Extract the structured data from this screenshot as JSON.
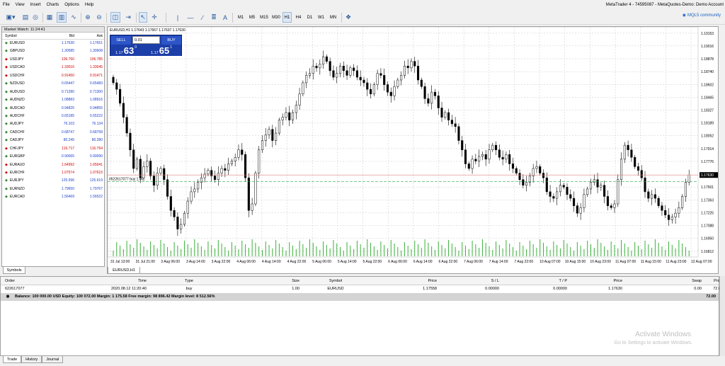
{
  "menu": [
    "File",
    "View",
    "Insert",
    "Charts",
    "Options",
    "Help"
  ],
  "title": "MetaTrader 4 - 74595087 - MetaQuotes-Demo: Demo Account",
  "toolbar": {
    "timeframes": [
      "M1",
      "M5",
      "M15",
      "M30",
      "H1",
      "H4",
      "D1",
      "W1",
      "MN"
    ],
    "selected_timeframe": "H1",
    "mql5_link": "MQL5 community"
  },
  "market_watch": {
    "title": "Market Watch: 11:24:41",
    "col_symbol": "Symbol",
    "col_bid": "Bid",
    "col_ask": "Ask",
    "tab": "Symbols",
    "rows": [
      {
        "symbol": "EURUSD",
        "bid": "1.17630",
        "ask": "1.17651",
        "dir": "up"
      },
      {
        "symbol": "GBPUSD",
        "bid": "1.30585",
        "ask": "1.30608",
        "dir": "up"
      },
      {
        "symbol": "USDJPY",
        "bid": "106.760",
        "ask": "106.785",
        "dir": "down"
      },
      {
        "symbol": "USDCAD",
        "bid": "1.33016",
        "ask": "1.33045",
        "dir": "down"
      },
      {
        "symbol": "USDCHF",
        "bid": "0.91450",
        "ask": "0.91471",
        "dir": "down"
      },
      {
        "symbol": "NZDUSD",
        "bid": "0.65447",
        "ask": "0.65483",
        "dir": "up"
      },
      {
        "symbol": "AUDUSD",
        "bid": "0.71280",
        "ask": "0.71300",
        "dir": "up"
      },
      {
        "symbol": "AUDNZD",
        "bid": "1.08883",
        "ask": "1.08916",
        "dir": "up"
      },
      {
        "symbol": "AUDCAD",
        "bid": "0.94825",
        "ask": "0.94855",
        "dir": "up"
      },
      {
        "symbol": "AUDCHF",
        "bid": "0.65185",
        "ask": "0.65222",
        "dir": "up"
      },
      {
        "symbol": "AUDJPY",
        "bid": "76.103",
        "ask": "76.134",
        "dir": "up"
      },
      {
        "symbol": "CADCHF",
        "bid": "0.68747",
        "ask": "0.68758",
        "dir": "up"
      },
      {
        "symbol": "CADJPY",
        "bid": "80.245",
        "ask": "80.280",
        "dir": "up"
      },
      {
        "symbol": "CHFJPY",
        "bid": "116.717",
        "ask": "116.764",
        "dir": "down"
      },
      {
        "symbol": "EURGBP",
        "bid": "0.90065",
        "ask": "0.90090",
        "dir": "up"
      },
      {
        "symbol": "EURAUD",
        "bid": "1.64992",
        "ask": "1.65041",
        "dir": "down"
      },
      {
        "symbol": "EURCHF",
        "bid": "1.07574",
        "ask": "1.07615",
        "dir": "down"
      },
      {
        "symbol": "EURJPY",
        "bid": "125.596",
        "ask": "125.619",
        "dir": "up"
      },
      {
        "symbol": "EURNZD",
        "bid": "1.79650",
        "ask": "1.79767",
        "dir": "up"
      },
      {
        "symbol": "EURCAD",
        "bid": "1.56469",
        "ask": "1.56522",
        "dir": "up"
      }
    ]
  },
  "chart": {
    "info": "EURUSD,H1  1.17643 1.17667 1.17637 1.17630",
    "tab": "EURUSD,H1",
    "sell_label": "SELL",
    "buy_label": "BUY",
    "lot": "0.01",
    "sell_small": "1.17",
    "sell_big": "63",
    "sell_tiny": "0",
    "buy_small": "1.17",
    "buy_big": "65",
    "buy_tiny": "1",
    "order_line_label": "#622617077 buy 1.00",
    "current_price_label": "1.17630"
  },
  "chart_data": {
    "type": "candlestick",
    "symbol": "EURUSD",
    "timeframe": "H1",
    "ylim": [
      1.1675,
      1.1922
    ],
    "y_ticks": [
      "1.19153",
      "1.19016",
      "1.18878",
      "1.18740",
      "1.18602",
      "1.18465",
      "1.18327",
      "1.18189",
      "1.18052",
      "1.17914",
      "1.17776",
      "1.17501",
      "1.17363",
      "1.17225",
      "1.17088",
      "1.16950",
      "1.16812"
    ],
    "x_ticks": [
      "31 Jul 13:00",
      "31 Jul 21:00",
      "3 Aug 06:00",
      "3 Aug 14:00",
      "3 Aug 22:00",
      "4 Aug 06:00",
      "4 Aug 14:00",
      "4 Aug 22:00",
      "5 Aug 06:00",
      "5 Aug 14:00",
      "5 Aug 22:00",
      "6 Aug 06:00",
      "6 Aug 14:00",
      "6 Aug 22:00",
      "7 Aug 06:00",
      "7 Aug 14:00",
      "7 Aug 22:00",
      "10 Aug 07:00",
      "10 Aug 15:00",
      "10 Aug 23:00",
      "11 Aug 07:00",
      "11 Aug 15:00",
      "11 Aug 23:00",
      "12 Aug 07:00"
    ],
    "closes": [
      1.1862,
      1.1855,
      1.184,
      1.1825,
      1.1808,
      1.179,
      1.177,
      1.178,
      1.176,
      1.1772,
      1.1778,
      1.1762,
      1.1752,
      1.1765,
      1.177,
      1.1758,
      1.174,
      1.1725,
      1.1718,
      1.1705,
      1.171,
      1.1722,
      1.1735,
      1.1745,
      1.1748,
      1.1755,
      1.176,
      1.1764,
      1.1768,
      1.1762,
      1.1758,
      1.1765,
      1.177,
      1.1768,
      1.1775,
      1.1778,
      1.1782,
      1.179,
      1.1785,
      1.176,
      1.1725,
      1.1732,
      1.1765,
      1.179,
      1.18,
      1.1806,
      1.1812,
      1.18,
      1.1808,
      1.1822,
      1.1825,
      1.183,
      1.1822,
      1.183,
      1.1838,
      1.185,
      1.1862,
      1.187,
      1.1872,
      1.188,
      1.1878,
      1.1882,
      1.189,
      1.1885,
      1.1875,
      1.1868,
      1.1872,
      1.188,
      1.1875,
      1.187,
      1.1878,
      1.1875,
      1.1868,
      1.1865,
      1.1862,
      1.1855,
      1.185,
      1.186,
      1.1872,
      1.187,
      1.186,
      1.1852,
      1.1848,
      1.1858,
      1.1865,
      1.187,
      1.188,
      1.1878,
      1.1885,
      1.188,
      1.1865,
      1.1858,
      1.1845,
      1.184,
      1.1852,
      1.1848,
      1.1835,
      1.1825,
      1.183,
      1.1822,
      1.1818,
      1.1815,
      1.18,
      1.179,
      1.1775,
      1.177,
      1.178,
      1.1778,
      1.1783,
      1.1785,
      1.178,
      1.179,
      1.1795,
      1.179,
      1.1782,
      1.178,
      1.1785,
      1.1775,
      1.177,
      1.1765,
      1.1758,
      1.1752,
      1.1755,
      1.1762,
      1.177,
      1.1772,
      1.1765,
      1.176,
      1.1745,
      1.174,
      1.1738,
      1.1745,
      1.1752,
      1.175,
      1.1742,
      1.1738,
      1.173,
      1.1722,
      1.1728,
      1.1742,
      1.1748,
      1.1755,
      1.1758,
      1.175,
      1.1752,
      1.174,
      1.173,
      1.1728,
      1.1732,
      1.1758,
      1.178,
      1.1795,
      1.179,
      1.1782,
      1.1772,
      1.1768,
      1.176,
      1.1745,
      1.1738,
      1.1742,
      1.1738,
      1.173,
      1.1725,
      1.172,
      1.1715,
      1.1718,
      1.1722,
      1.1728,
      1.174,
      1.1755,
      1.1763
    ]
  },
  "terminal": {
    "headers": [
      "Order",
      "Time",
      "Type",
      "Size",
      "Symbol",
      "Price",
      "S / L",
      "T / P",
      "Price",
      "Swap",
      "Profit"
    ],
    "row": [
      "622617077",
      "2020.08.12 11:20:40",
      "buy",
      "1.00",
      "EURUSD",
      "1.17558",
      "0.00000",
      "0.00000",
      "1.17630",
      "0.00",
      "72.00"
    ],
    "balance": "Balance: 100 000.00 USD  Equity: 100 072.00  Margin: 1 175.58  Free margin: 98 896.42  Margin level: 8 512.56%",
    "balance_profit": "72.00",
    "tabs": [
      "Trade",
      "History",
      "Journal"
    ],
    "active_tab": "Trade"
  },
  "watermark": {
    "line1": "Activate Windows",
    "line2": "Go to Settings to activate Windows."
  }
}
